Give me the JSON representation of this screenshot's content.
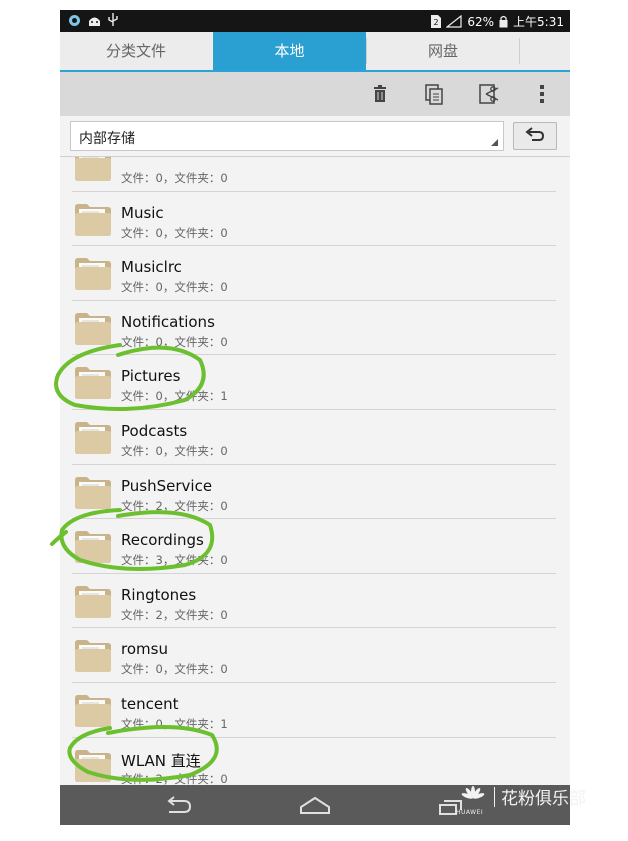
{
  "status_bar": {
    "battery_text": "62%",
    "time": "上午5:31",
    "left_icons": [
      "sync-icon",
      "android-icon",
      "usb-icon"
    ],
    "right_icons": [
      "sim-icon",
      "signal-icon",
      "lock-icon"
    ]
  },
  "tabs": [
    {
      "label": "分类文件",
      "active": false
    },
    {
      "label": "本地",
      "active": true
    },
    {
      "label": "网盘",
      "active": false
    }
  ],
  "toolbar": {
    "icons": [
      "delete-icon",
      "copy-icon",
      "cut-icon",
      "more-icon"
    ]
  },
  "path": {
    "current": "内部存储",
    "back_icon": "back-arrow-icon"
  },
  "folders": [
    {
      "name": "",
      "meta": "文件：0，文件夹：0"
    },
    {
      "name": "Music",
      "meta": "文件：0，文件夹：0"
    },
    {
      "name": "Musiclrc",
      "meta": "文件：0，文件夹：0"
    },
    {
      "name": "Notifications",
      "meta": "文件：0，文件夹：0"
    },
    {
      "name": "Pictures",
      "meta": "文件：0，文件夹：1"
    },
    {
      "name": "Podcasts",
      "meta": "文件：0，文件夹：0"
    },
    {
      "name": "PushService",
      "meta": "文件：2，文件夹：0"
    },
    {
      "name": "Recordings",
      "meta": "文件：3，文件夹：0"
    },
    {
      "name": "Ringtones",
      "meta": "文件：2，文件夹：0"
    },
    {
      "name": "romsu",
      "meta": "文件：0，文件夹：0"
    },
    {
      "name": "tencent",
      "meta": "文件：0，文件夹：1"
    },
    {
      "name": "WLAN 直连",
      "meta": "文件：2，文件夹：0"
    }
  ],
  "nav_bar": {
    "icons": [
      "back-icon",
      "home-icon",
      "recents-icon"
    ]
  },
  "watermark": {
    "brand": "HUAWEI",
    "text": "花粉俱乐部"
  },
  "colors": {
    "accent": "#2a9fd1",
    "highlight_circle": "#6cbf2f",
    "folder": "#d8c6a0"
  }
}
